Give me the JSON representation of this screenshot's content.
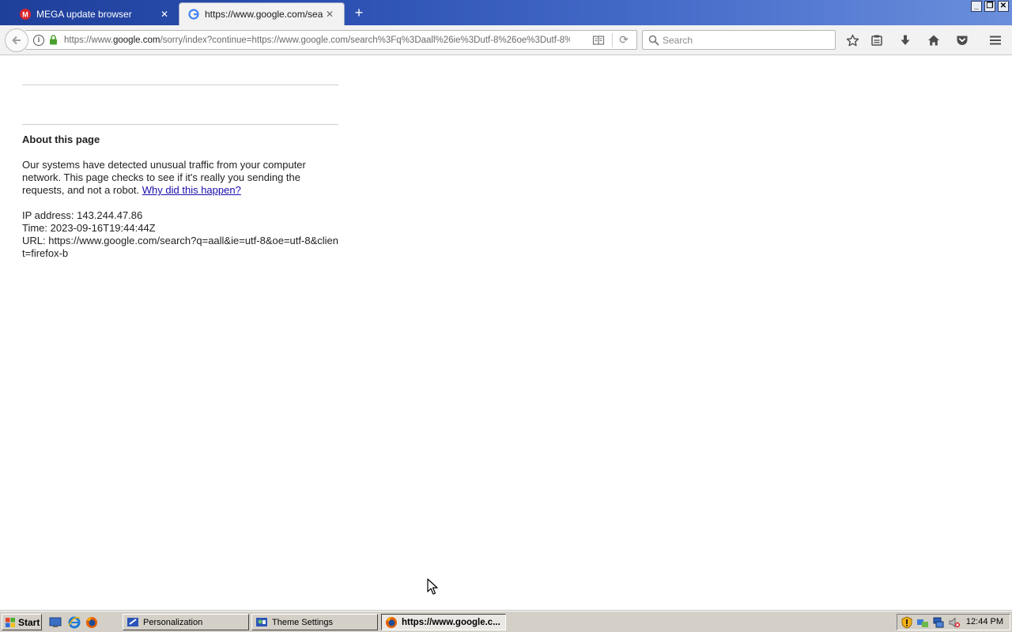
{
  "browser": {
    "tabs": [
      {
        "title": "MEGA update browser",
        "favicon": "mega-icon",
        "active": false
      },
      {
        "title": "https://www.google.com/sea...",
        "favicon": "google-icon",
        "active": true
      }
    ],
    "new_tab_label": "+",
    "window_controls": {
      "minimize": "_",
      "restore": "❐",
      "close": "✕"
    },
    "url_host_prefix": "https://www.",
    "url_host": "google.com",
    "url_path": "/sorry/index?continue=https://www.google.com/search%3Fq%3Daall%26ie%3Dutf-8%26oe%3Dutf-8%2",
    "search_placeholder": "Search",
    "toolbar_icons": [
      "bookmark-star-icon",
      "reading-list-icon",
      "download-icon",
      "home-icon",
      "pocket-icon",
      "menu-icon"
    ]
  },
  "page": {
    "heading": "About this page",
    "blurb": "Our systems have detected unusual traffic from your computer network. This page checks to see if it's really you sending the requests, and not a robot.",
    "link": "Why did this happen?",
    "ip_line": "IP address: 143.244.47.86",
    "time_line": "Time: 2023-09-16T19:44:44Z",
    "url_line": "URL: https://www.google.com/search?q=aall&ie=utf-8&oe=utf-8&client=firefox-b"
  },
  "taskbar": {
    "start_label": "Start",
    "quick_launch": [
      "show-desktop-icon",
      "internet-explorer-icon",
      "firefox-icon"
    ],
    "buttons": [
      {
        "label": "Personalization",
        "active": false
      },
      {
        "label": "Theme Settings",
        "active": false
      },
      {
        "label": "https://www.google.c...",
        "active": true
      }
    ],
    "tray_icons": [
      "security-alert-icon",
      "network-connections-icon",
      "network-icon",
      "volume-muted-icon"
    ],
    "clock": "12:44 PM"
  }
}
